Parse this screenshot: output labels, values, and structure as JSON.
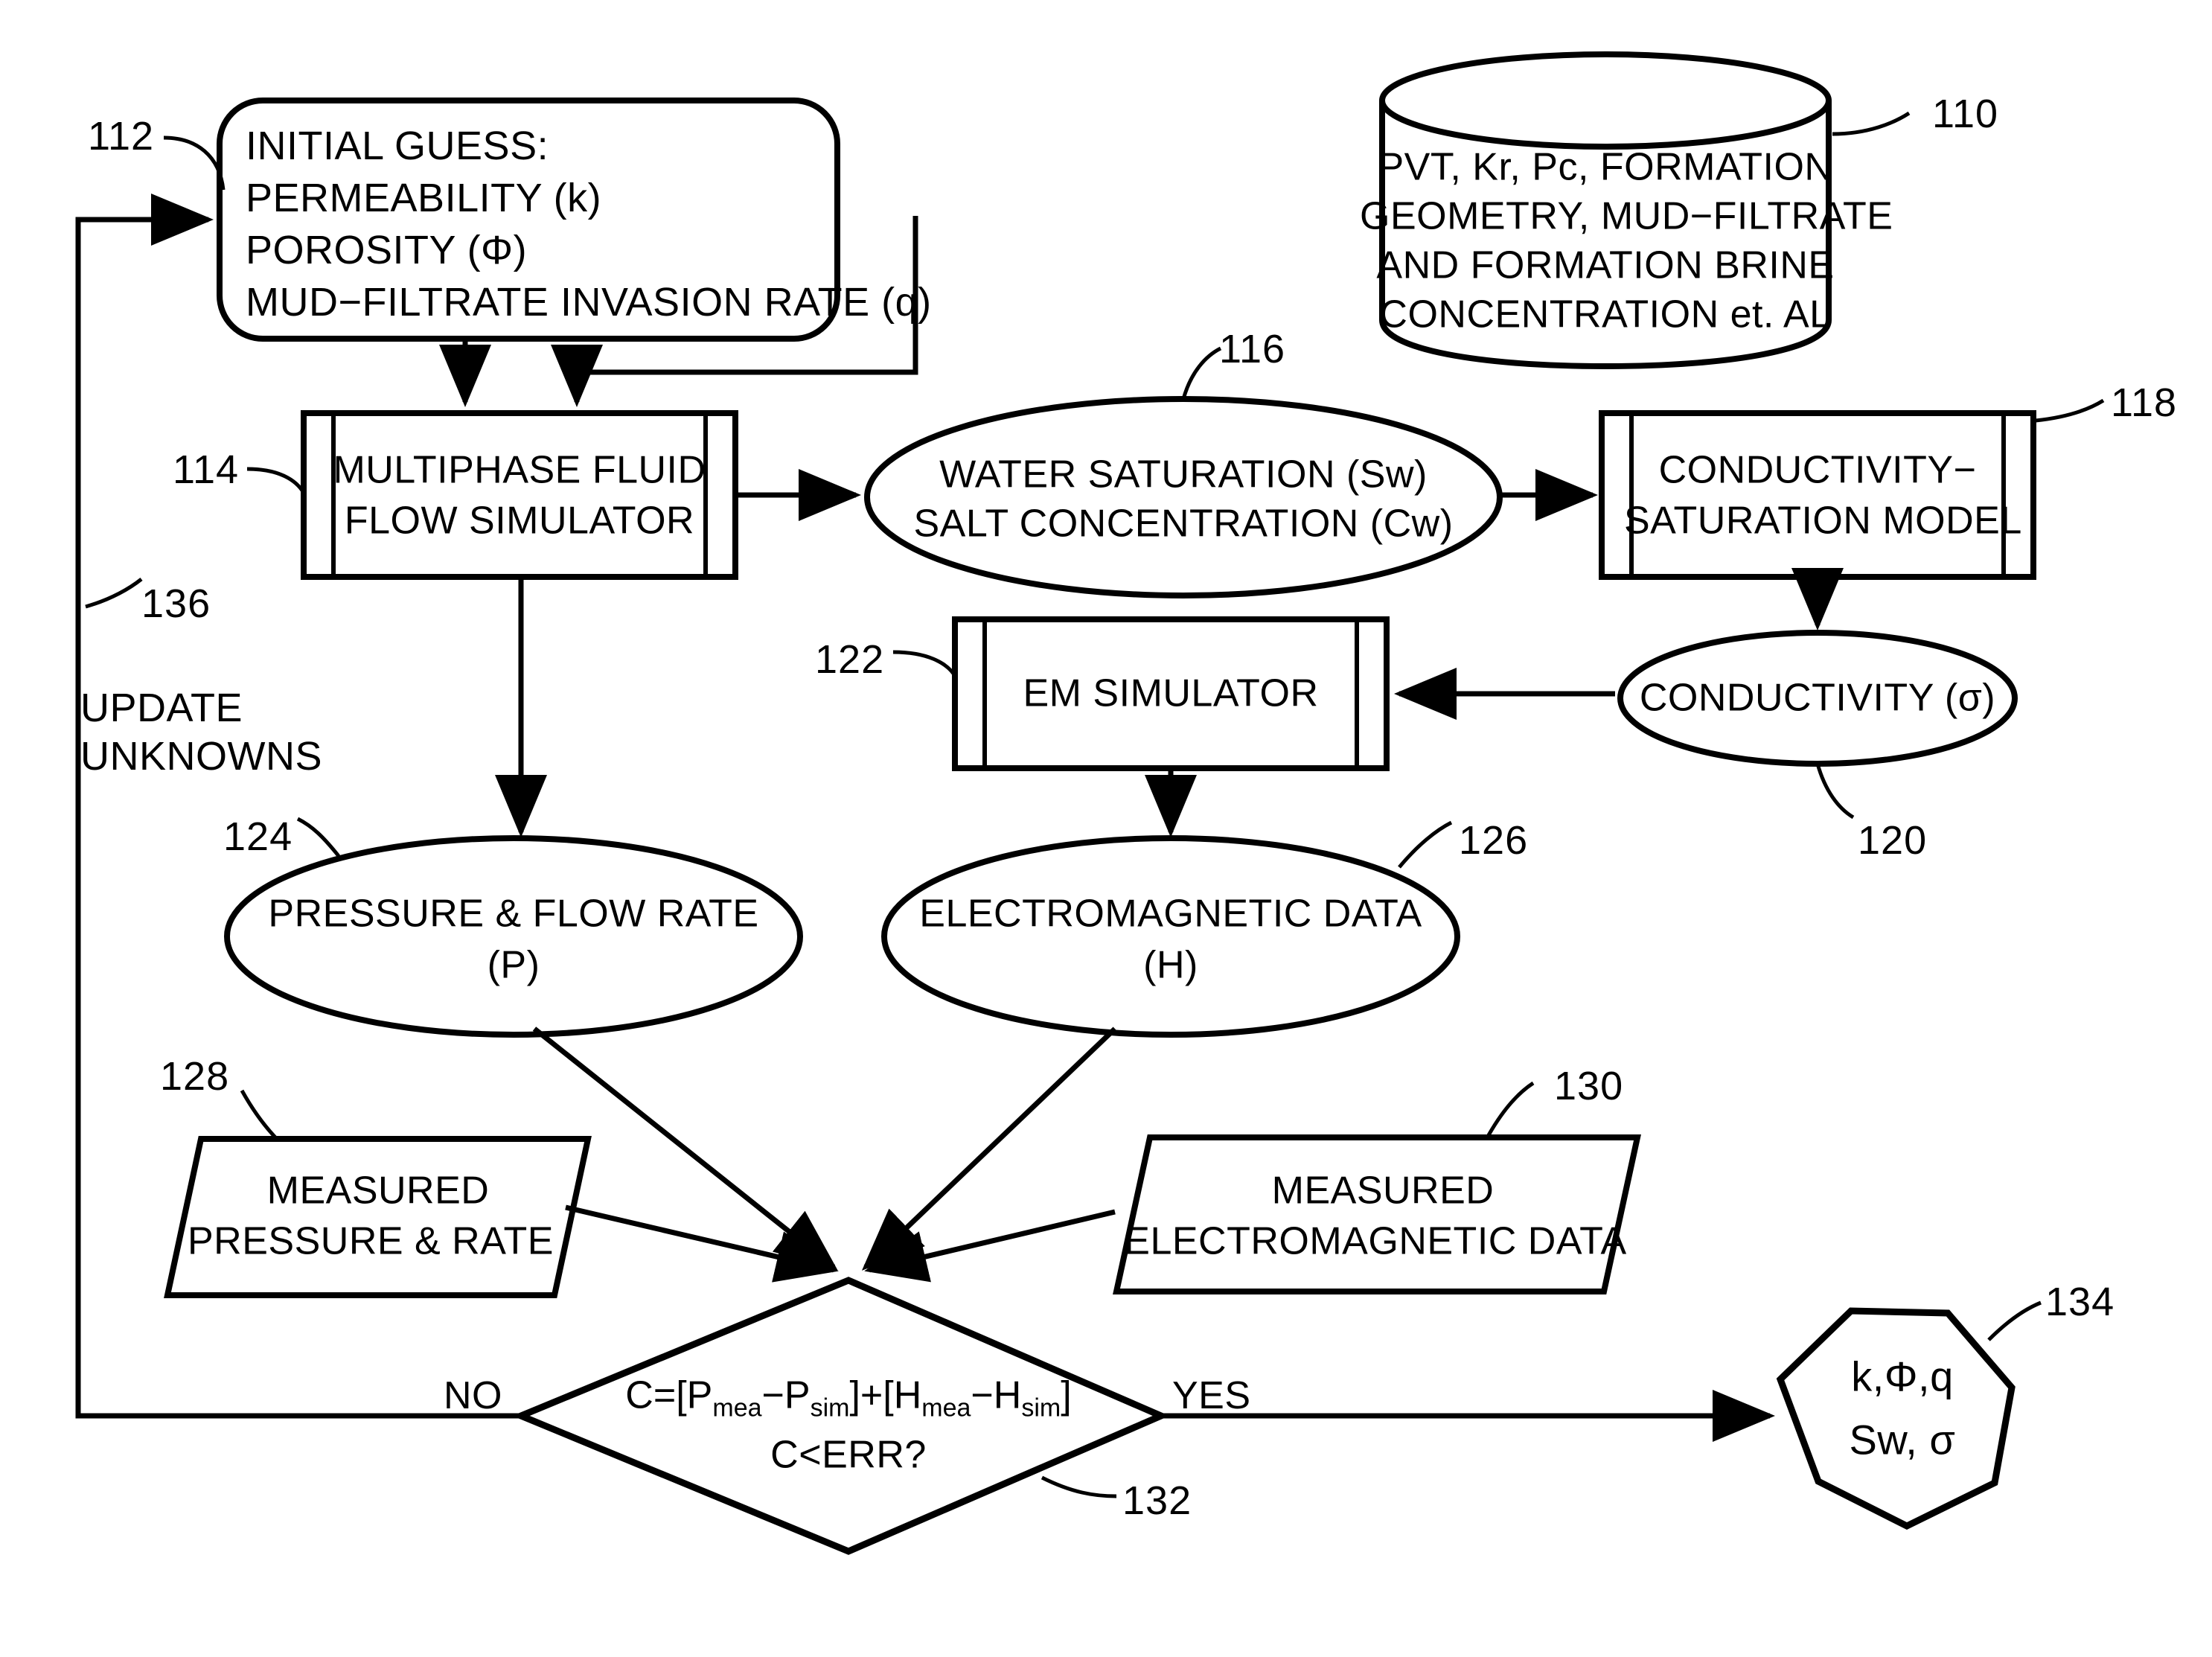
{
  "diagram": {
    "type": "patent-flowchart",
    "background": "#ffffff",
    "line_color": "#000000"
  },
  "nodes": {
    "initial_guess": {
      "ref": "112",
      "shape": "rounded-rectangle",
      "lines": [
        "INITIAL GUESS:",
        "PERMEABILITY (k)",
        "POROSITY (Φ)",
        "MUD−FILTRATE INVASION RATE (q)"
      ]
    },
    "database": {
      "ref": "110",
      "shape": "cylinder",
      "lines": [
        "PVT, Kr, Pc, FORMATION",
        "GEOMETRY, MUD−FILTRATE",
        "AND FORMATION BRINE",
        "CONCENTRATION et. AL"
      ]
    },
    "fluid_flow_simulator": {
      "ref": "114",
      "shape": "predefined-process",
      "lines": [
        "MULTIPHASE FLUID",
        "FLOW SIMULATOR"
      ]
    },
    "water_saturation": {
      "ref": "116",
      "shape": "ellipse",
      "lines": [
        "WATER SATURATION (Sw)",
        "SALT CONCENTRATION (Cw)"
      ]
    },
    "conductivity_saturation_model": {
      "ref": "118",
      "shape": "predefined-process",
      "lines": [
        "CONDUCTIVITY−",
        "SATURATION MODEL"
      ]
    },
    "conductivity": {
      "ref": "120",
      "shape": "ellipse",
      "lines": [
        "CONDUCTIVITY (σ)"
      ]
    },
    "em_simulator": {
      "ref": "122",
      "shape": "predefined-process",
      "lines": [
        "EM SIMULATOR"
      ]
    },
    "pressure_flow_rate": {
      "ref": "124",
      "shape": "ellipse",
      "lines": [
        "PRESSURE & FLOW RATE",
        "(P)"
      ]
    },
    "electromagnetic_data": {
      "ref": "126",
      "shape": "ellipse",
      "lines": [
        "ELECTROMAGNETIC DATA",
        "(H)"
      ]
    },
    "measured_pressure_rate": {
      "ref": "128",
      "shape": "parallelogram",
      "lines": [
        "MEASURED",
        "PRESSURE & RATE"
      ]
    },
    "measured_em_data": {
      "ref": "130",
      "shape": "parallelogram",
      "lines": [
        "MEASURED",
        "ELECTROMAGNETIC DATA"
      ]
    },
    "decision": {
      "ref": "132",
      "shape": "diamond",
      "formula_prefix": "C=[P",
      "formula_sub1": "mea",
      "formula_mid1": "−P",
      "formula_sub2": "sim",
      "formula_mid2": "]+[H",
      "formula_sub3": "mea",
      "formula_mid3": "−H",
      "formula_sub4": "sim",
      "formula_suffix": "]",
      "line2": "C<ERR?"
    },
    "output": {
      "ref": "134",
      "shape": "heptagon",
      "lines": [
        "k,Φ,q",
        "Sw, σ"
      ]
    },
    "update_unknowns": {
      "ref": "136",
      "shape": "annotation",
      "lines": [
        "UPDATE",
        "UNKNOWNS"
      ]
    }
  },
  "edge_labels": {
    "no": "NO",
    "yes": "YES"
  }
}
